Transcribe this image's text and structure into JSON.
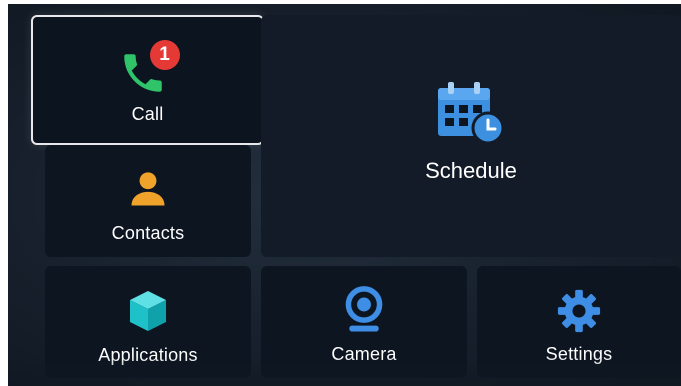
{
  "tiles": {
    "call": {
      "label": "Call",
      "icon": "phone-icon",
      "badge": "1"
    },
    "contacts": {
      "label": "Contacts",
      "icon": "person-icon"
    },
    "schedule": {
      "label": "Schedule",
      "icon": "calendar-clock-icon"
    },
    "applications": {
      "label": "Applications",
      "icon": "cube-icon"
    },
    "camera": {
      "label": "Camera",
      "icon": "webcam-icon"
    },
    "settings": {
      "label": "Settings",
      "icon": "gear-icon"
    }
  },
  "colors": {
    "phone": "#2fc36a",
    "badge": "#e53935",
    "person": "#f0a32a",
    "calendar": "#3d8fe0",
    "cube": "#1fc1c9",
    "camera": "#3f8ee6",
    "gear": "#3f8ee6"
  }
}
